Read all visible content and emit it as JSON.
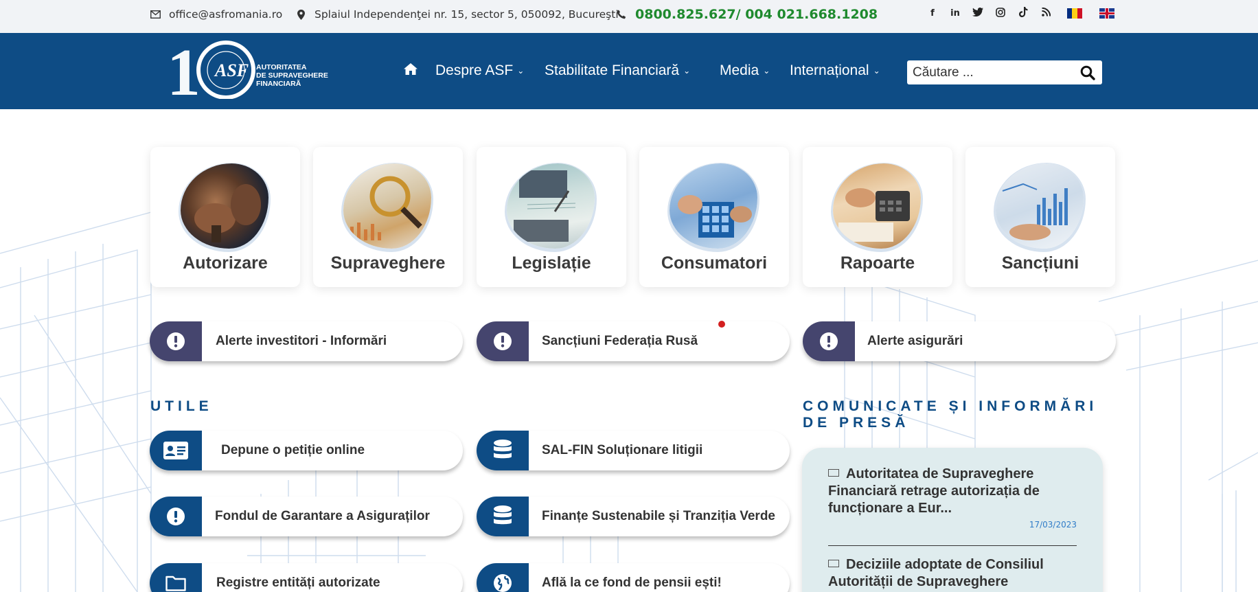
{
  "topbar": {
    "email": "office@asfromania.ro",
    "address": "Splaiul Independenţei nr. 15, sector 5, 050092, Bucureşti",
    "phone": "0800.825.627/ 004 021.668.1208",
    "social_icons": [
      "facebook-icon",
      "linkedin-icon",
      "twitter-icon",
      "instagram-icon",
      "tiktok-icon",
      "rss-icon"
    ],
    "languages": [
      "ro",
      "en"
    ]
  },
  "header": {
    "logo_number": "10",
    "logo_line1": "AUTORITATEA",
    "logo_line2": "DE SUPRAVEGHERE",
    "logo_line3": "FINANCIARĂ",
    "nav": [
      {
        "label": "Despre ASF"
      },
      {
        "label": "Stabilitate Financiară"
      },
      {
        "label": "Media"
      },
      {
        "label": "Internațional"
      }
    ],
    "search_placeholder": "Căutare ..."
  },
  "cards": [
    {
      "label": "Autorizare"
    },
    {
      "label": "Supraveghere"
    },
    {
      "label": "Legislație"
    },
    {
      "label": "Consumatori"
    },
    {
      "label": "Rapoarte"
    },
    {
      "label": "Sancțiuni"
    }
  ],
  "alerts": [
    {
      "label": "Alerte investitori - Informări"
    },
    {
      "label": "Sancțiuni Federația Rusă"
    },
    {
      "label": "Alerte asigurări"
    }
  ],
  "utile": {
    "title": "UTILE",
    "links": [
      {
        "label": "Depune o petiție online"
      },
      {
        "label": "SAL-FIN Soluționare litigii"
      },
      {
        "label": "Fondul de Garantare a Asiguraților"
      },
      {
        "label": "Finanțe Sustenabile și Tranziția Verde"
      },
      {
        "label": "Registre entități autorizate"
      },
      {
        "label": "Află la ce fond de pensii ești!"
      }
    ]
  },
  "press": {
    "title_line1": "COMUNICATE ȘI INFORMĂRI",
    "title_line2": "DE PRESĂ",
    "items": [
      {
        "title": "Autoritatea de Supraveghere Financiară retrage autorizația de funcționare a Eur...",
        "date": "17/03/2023"
      },
      {
        "title": "Deciziile adoptate de Consiliul Autorității de Supraveghere",
        "date": ""
      }
    ]
  },
  "colors": {
    "header_bg": "#0e4c85",
    "alert_cap": "#45456e",
    "phone": "#1f8a2e",
    "news_bg": "#dfecee"
  }
}
